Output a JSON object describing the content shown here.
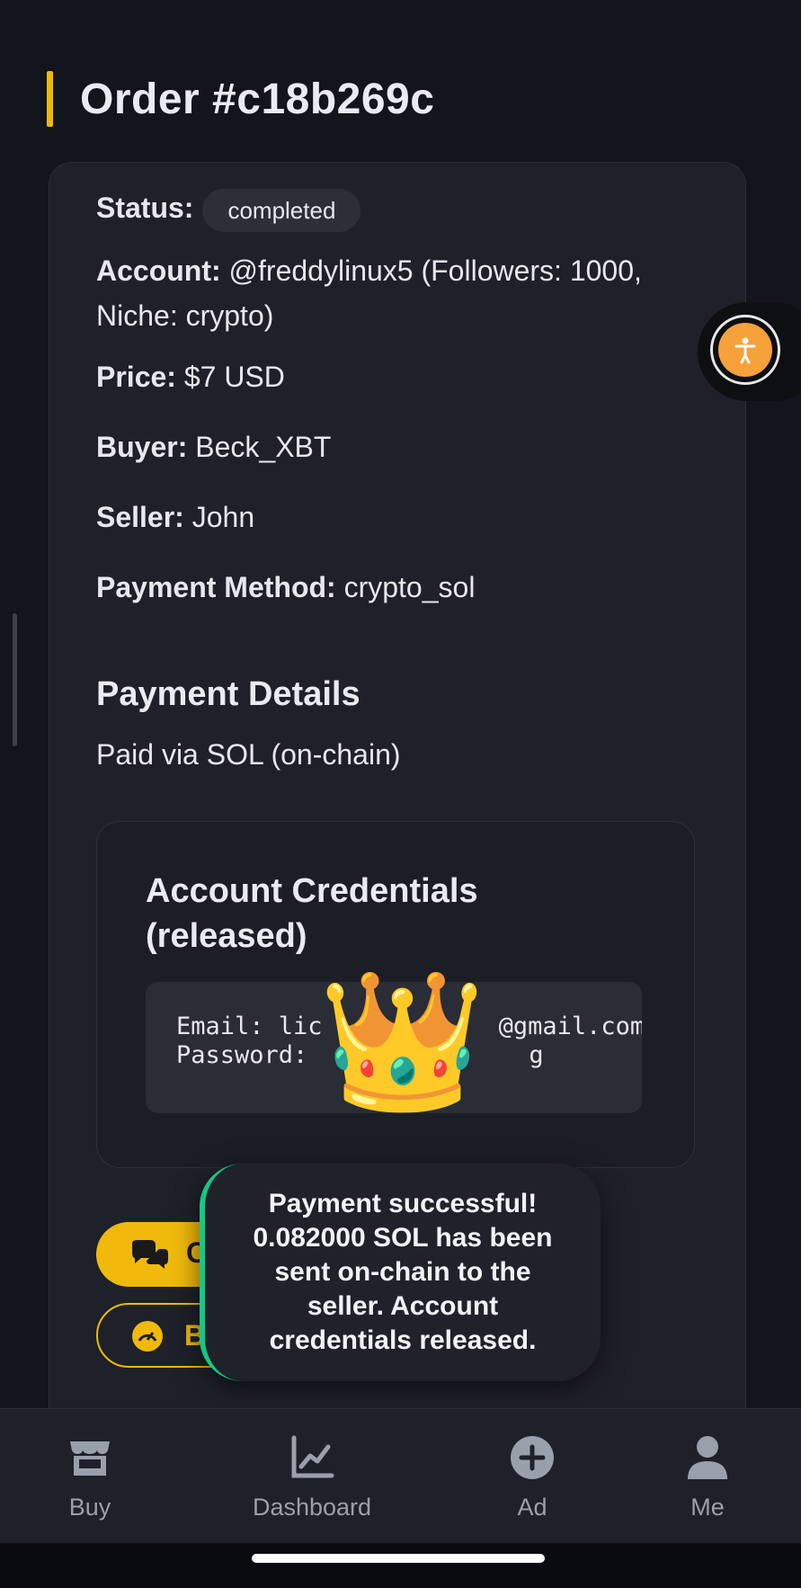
{
  "header": {
    "title": "Order #c18b269c"
  },
  "order": {
    "status_label": "Status:",
    "status_value": "completed",
    "account_label": "Account:",
    "account_value_line1": " @freddylinux5 (Followers: 1000,",
    "account_value_line2": "Niche: crypto)",
    "price_label": "Price:",
    "price_value": " $7 USD",
    "buyer_label": "Buyer:",
    "buyer_value": " Beck_XBT",
    "seller_label": "Seller:",
    "seller_value": " John",
    "payment_method_label": "Payment Method:",
    "payment_method_value": " crypto_sol",
    "payment_details_heading": "Payment Details",
    "payment_details_text": "Paid via SOL (on-chain)"
  },
  "credentials": {
    "title": "Account Credentials (released)",
    "email_line": "Email: lic",
    "email_suffix": "@gmail.com",
    "password_line": "Password:",
    "password_tail": "g"
  },
  "buttons": {
    "chat_label": "C",
    "b_label": "B"
  },
  "overlay": {
    "crown_emoji": "👑"
  },
  "toast": {
    "message": "Payment successful! 0.082000 SOL has been sent on-chain to the seller. Account credentials released.",
    "accent": "#16c784"
  },
  "nav": {
    "items": [
      {
        "label": "Buy",
        "icon": "store-icon"
      },
      {
        "label": "Dashboard",
        "icon": "chart-line-icon"
      },
      {
        "label": "Ad",
        "icon": "plus-circle-icon"
      },
      {
        "label": "Me",
        "icon": "user-icon"
      }
    ]
  },
  "colors": {
    "accent": "#f0b90b",
    "background": "#12151c",
    "card": "#1e2129",
    "a11y": "#f6a13a"
  }
}
